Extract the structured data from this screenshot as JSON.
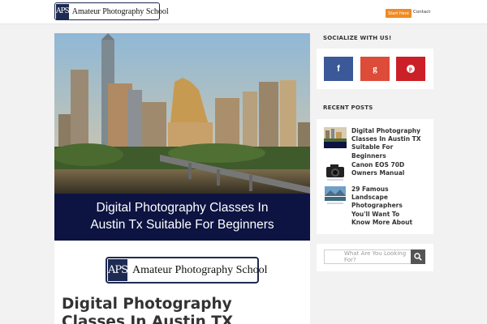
{
  "header": {
    "logo_mark": "APS",
    "logo_text": "Amateur Photography School",
    "start_button": "Start Here",
    "contact_link": "Contact"
  },
  "article": {
    "hero_caption_line1": "Digital Photography Classes In",
    "hero_caption_line2": "Austin Tx Suitable For Beginners",
    "logo_mark": "APS",
    "logo_text": "Amateur Photography School",
    "title_line1": "Digital Photography",
    "title_line2": "Classes In Austin TX"
  },
  "sidebar": {
    "socialize_title": "SOCIALIZE WITH US!",
    "social": [
      {
        "icon": "facebook-icon",
        "glyph": "f",
        "color": "#3b5998"
      },
      {
        "icon": "google-plus-icon",
        "glyph": "g",
        "color": "#dd4b39"
      },
      {
        "icon": "pinterest-icon",
        "glyph": "p",
        "color": "#cb2027"
      }
    ],
    "recent_title": "RECENT POSTS",
    "recent_posts": [
      {
        "line1": "Digital Photography",
        "line2": "Classes In Austin TX",
        "line3": "Suitable For",
        "line4": "Beginners"
      },
      {
        "line1": "Canon EOS 70D",
        "line2": "Owners Manual"
      },
      {
        "line1": "29 Famous",
        "line2": "Landscape",
        "line3": "Photographers",
        "line4": "You'll Want To",
        "line5": "Know More About"
      }
    ],
    "search_placeholder": "What Are You Looking For?"
  }
}
